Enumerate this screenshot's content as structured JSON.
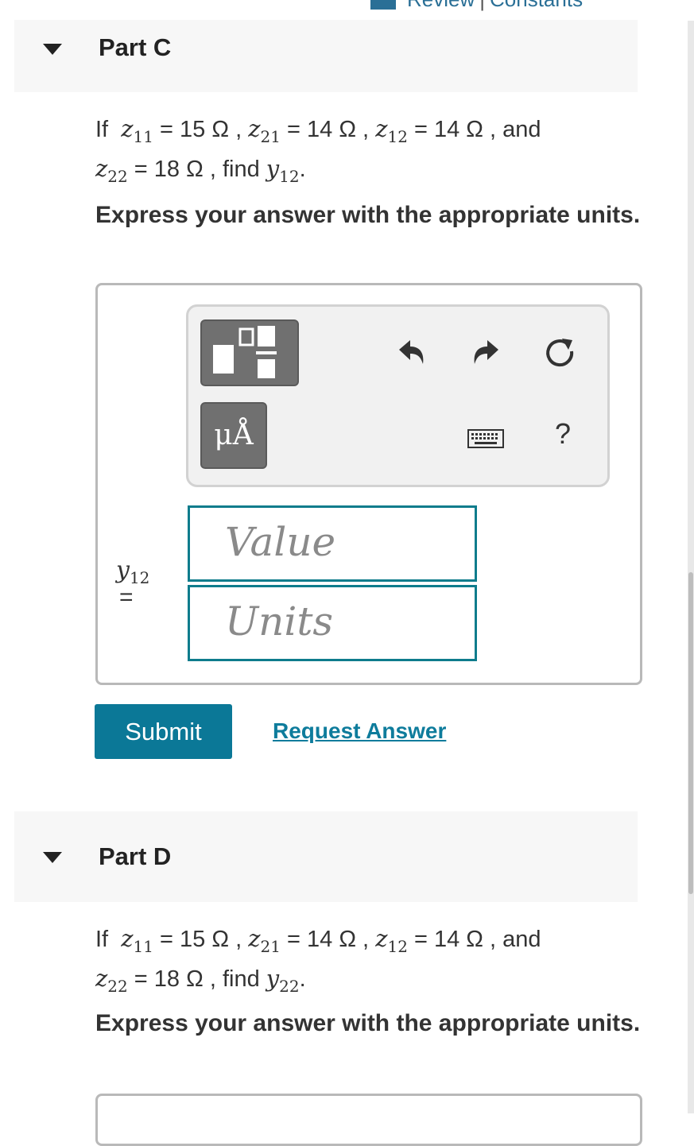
{
  "header": {
    "review_label": "Review",
    "separator": "|",
    "constants_label": "Constants"
  },
  "part_c": {
    "title": "Part C",
    "given": {
      "prefix": "If",
      "z11_label": "z",
      "z11_sub": "11",
      "z11_value": "= 15 Ω ,",
      "z21_sub": "21",
      "z21_value": "= 14 Ω ,",
      "z12_sub": "12",
      "z12_value": "= 14 Ω , and",
      "z22_sub": "22",
      "z22_value": "= 18 Ω , find",
      "find_var": "y",
      "find_sub": "12",
      "end": "."
    },
    "instruction": "Express your answer with the appropriate units.",
    "answer_label_var": "y",
    "answer_label_sub": "12",
    "answer_label_eq": "=",
    "value_placeholder": "Value",
    "units_placeholder": "Units",
    "unit_button_label": "μÅ",
    "help_label": "?",
    "submit_label": "Submit",
    "request_answer_label": "Request Answer"
  },
  "part_d": {
    "title": "Part D",
    "given": {
      "prefix": "If",
      "z11_sub": "11",
      "z11_value": "= 15 Ω ,",
      "z21_sub": "21",
      "z21_value": "= 14 Ω ,",
      "z12_sub": "12",
      "z12_value": "= 14 Ω , and",
      "z22_sub": "22",
      "z22_value": "= 18 Ω , find",
      "find_var": "y",
      "find_sub": "22",
      "end": "."
    },
    "instruction": "Express your answer with the appropriate units."
  },
  "icons": [
    "templates-icon",
    "units-icon",
    "undo-icon",
    "redo-icon",
    "reset-icon",
    "keyboard-icon",
    "help-icon"
  ],
  "colors": {
    "accent": "#0b7897",
    "field_border": "#0e7c8c",
    "link": "#0e7c9c",
    "part_bg": "#f7f7f7"
  }
}
